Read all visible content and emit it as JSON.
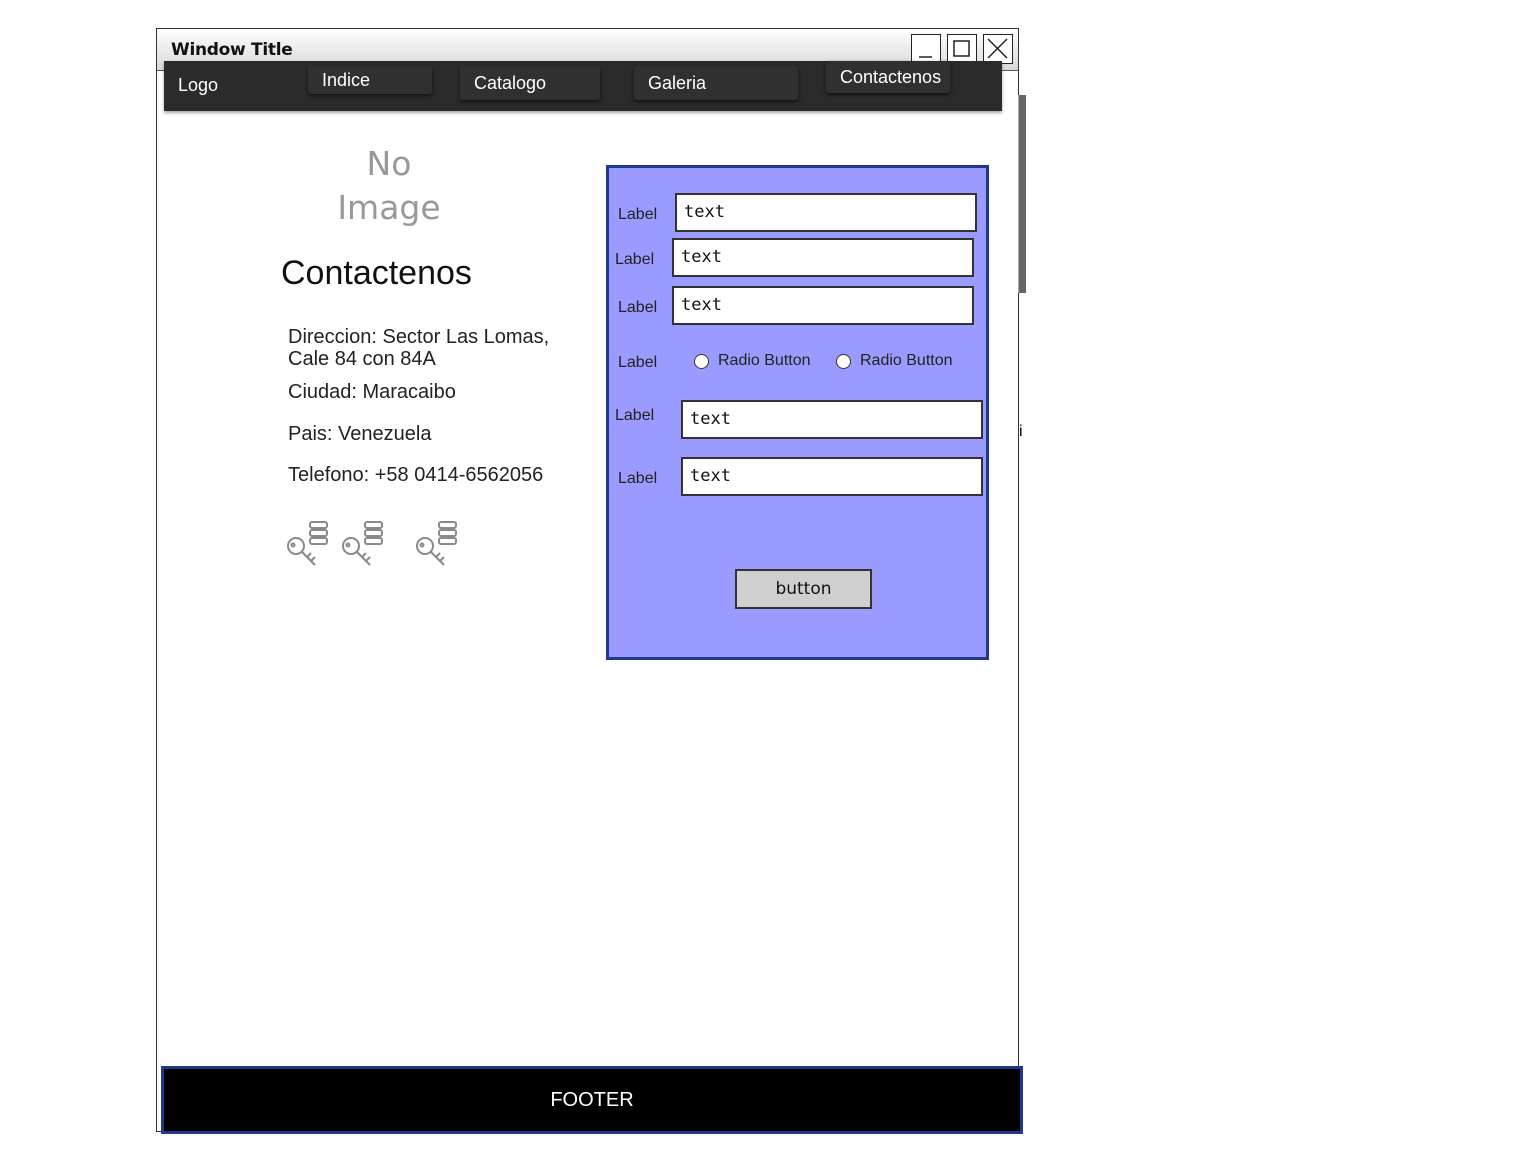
{
  "window": {
    "title": "Window Title"
  },
  "nav": {
    "logo": "Logo",
    "tabs": [
      "Indice",
      "Catalogo",
      "Galeria",
      "Contactenos"
    ]
  },
  "image_placeholder": "No Image",
  "page": {
    "heading": "Contactenos",
    "address_line1": "Direccion: Sector Las Lomas,",
    "address_line2": "Cale 84 con 84A",
    "city": "Ciudad: Maracaibo",
    "country": "Pais: Venezuela",
    "phone": "Telefono: +58 0414-6562056",
    "stray_char": "i"
  },
  "form": {
    "rows": [
      {
        "label": "Label",
        "value": "text"
      },
      {
        "label": "Label",
        "value": "text"
      },
      {
        "label": "Label",
        "value": "text"
      }
    ],
    "radio_label": "Label",
    "radios": [
      "Radio Button",
      "Radio Button"
    ],
    "rows2": [
      {
        "label": "Label",
        "value": "text"
      },
      {
        "label": "Label",
        "value": "text"
      }
    ],
    "button": "button"
  },
  "footer": "FOOTER",
  "colors": {
    "form_background": "#9b9bff",
    "form_border": "#1f3a8a",
    "navbar": "#2b2b2b",
    "footer": "#000000"
  }
}
